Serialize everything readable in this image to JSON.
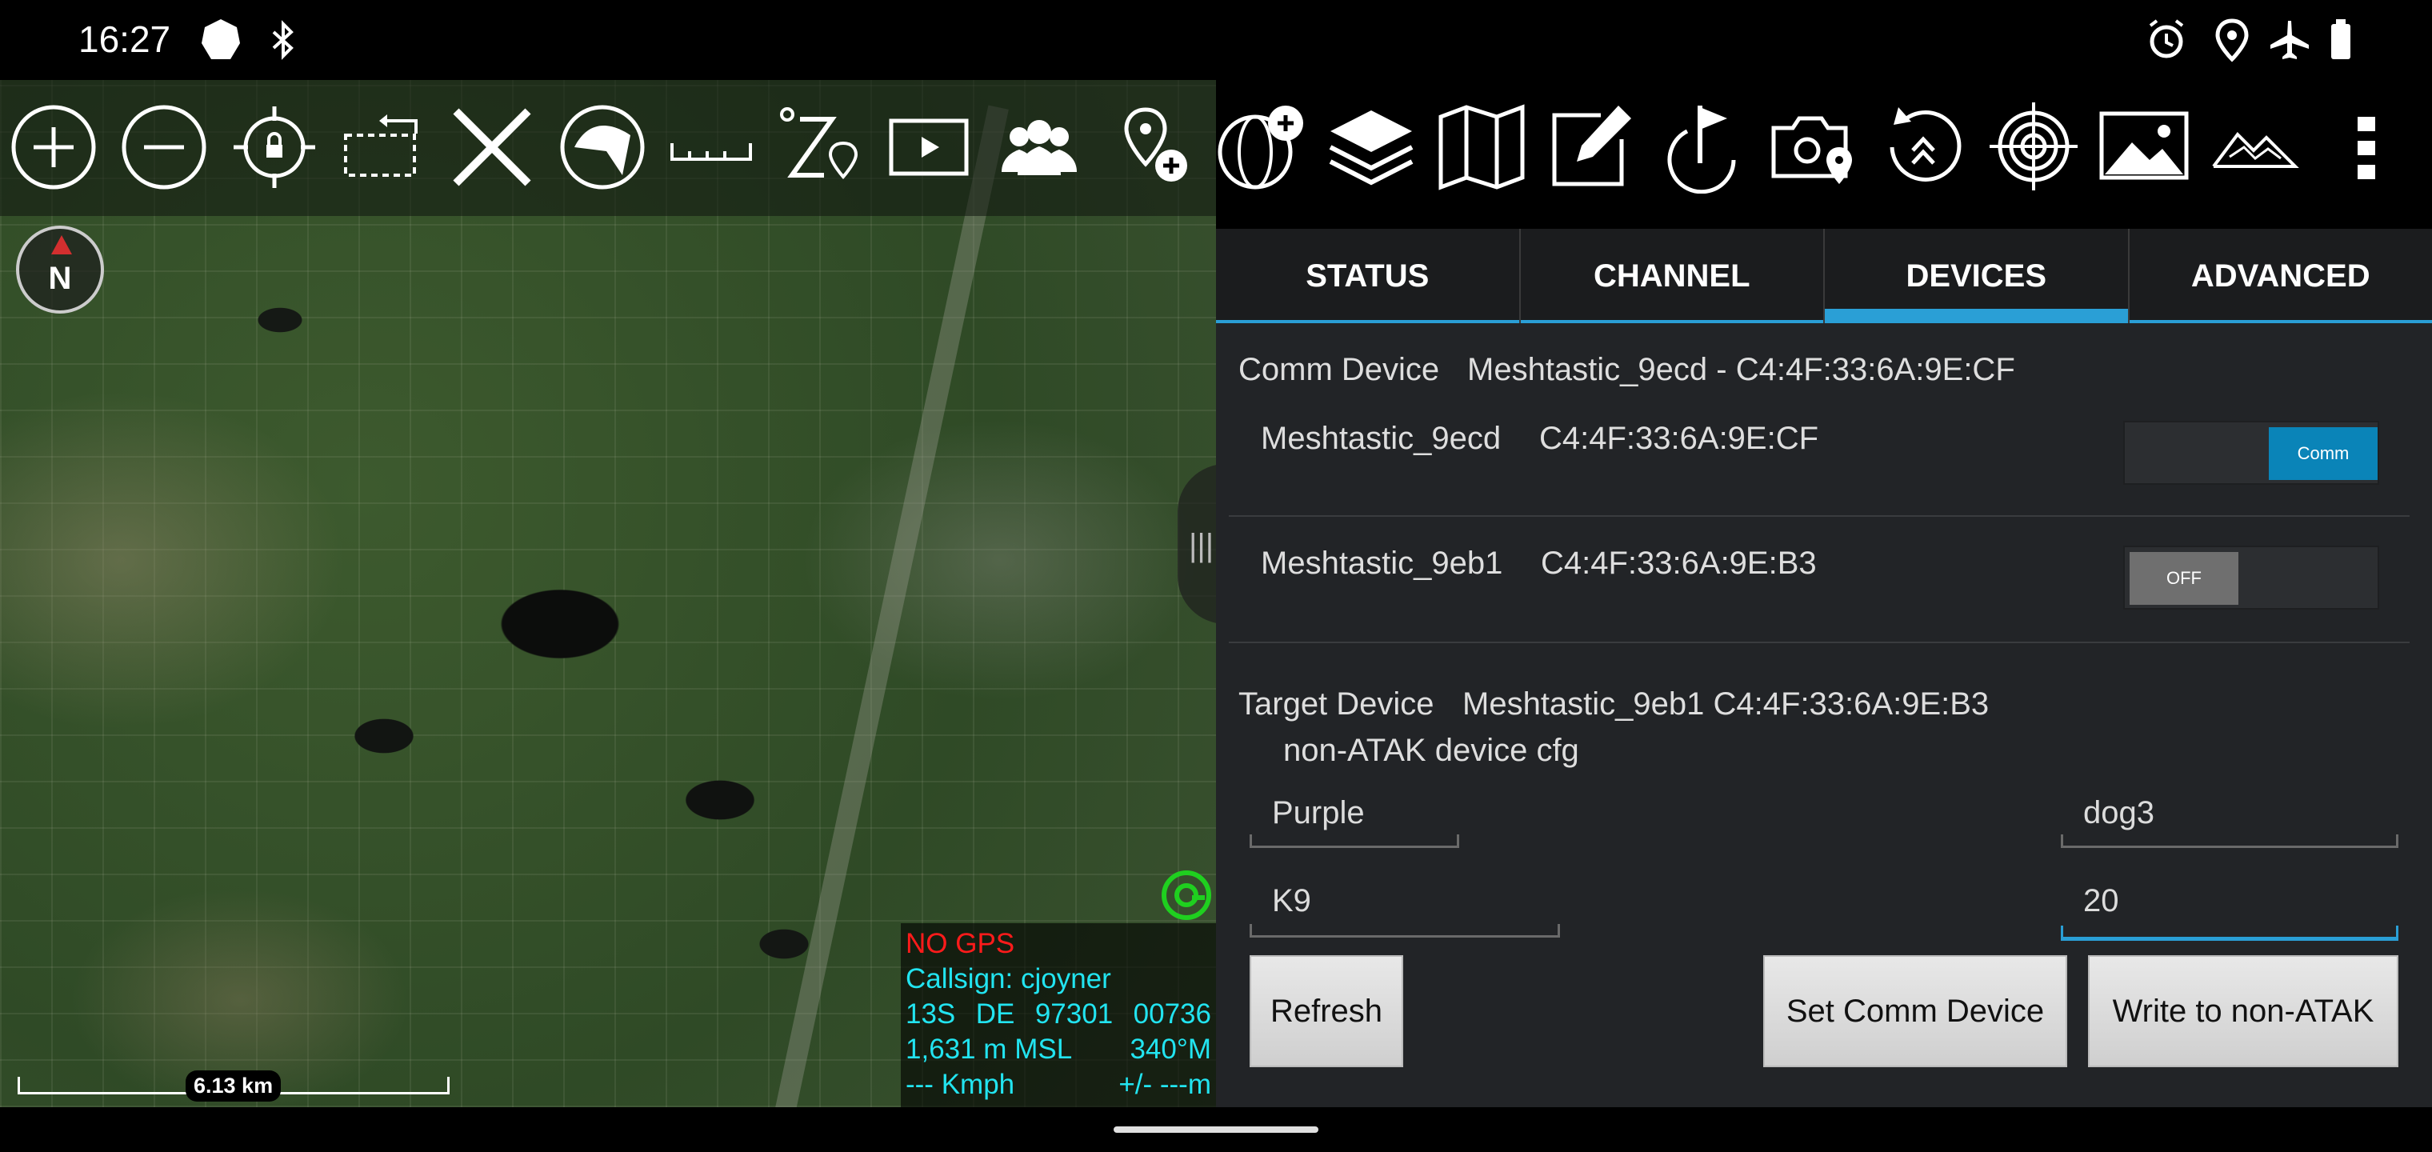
{
  "status_bar": {
    "time": "16:27",
    "left_icons": [
      "settings-badge-icon",
      "bluetooth-icon"
    ],
    "right_icons": [
      "alarm-icon",
      "location-pin-icon",
      "airplane-mode-icon",
      "battery-icon"
    ]
  },
  "map": {
    "toolbar_icons": [
      "zoom-in-icon",
      "zoom-out-icon",
      "lock-location-icon",
      "rotate-screen-icon",
      "close-x-icon",
      "shield-tool-icon",
      "ruler-icon",
      "route-icon",
      "video-icon",
      "contacts-icon",
      "add-point-icon"
    ],
    "compass_label": "N",
    "info": {
      "gps_status": "NO GPS",
      "callsign": "Callsign: cjoyner",
      "mgrs_zone": "13S",
      "mgrs_grid": "DE",
      "mgrs_east": "97301",
      "mgrs_north": "00736",
      "altitude": "1,631 m MSL",
      "heading": "340°M",
      "speed": "--- Kmph",
      "accuracy": "+/- ---m"
    },
    "scale_label": "6.13 km"
  },
  "panel_toolbar_icons": [
    "add-map-icon",
    "layers-icon",
    "map-icon",
    "edit-icon",
    "flag-pointer-icon",
    "camera-location-icon",
    "history-icon",
    "target-icon",
    "image-icon",
    "terrain-icon",
    "overflow-menu-icon"
  ],
  "tabs": [
    {
      "label": "STATUS"
    },
    {
      "label": "CHANNEL"
    },
    {
      "label": "DEVICES"
    },
    {
      "label": "ADVANCED"
    }
  ],
  "active_tab": "DEVICES",
  "devices": {
    "comm_label": "Comm Device",
    "comm_value": "Meshtastic_9ecd - C4:4F:33:6A:9E:CF",
    "list": [
      {
        "name": "Meshtastic_9ecd",
        "mac": "C4:4F:33:6A:9E:CF",
        "toggle": "Comm"
      },
      {
        "name": "Meshtastic_9eb1",
        "mac": "C4:4F:33:6A:9E:B3",
        "toggle": "OFF"
      }
    ],
    "target_label": "Target Device",
    "target_value": "Meshtastic_9eb1 C4:4F:33:6A:9E:B3",
    "nonatak_label": "non-ATAK device cfg",
    "fields": {
      "team": "Purple",
      "callsign": "dog3",
      "role": "K9",
      "number": "20"
    },
    "buttons": {
      "refresh": "Refresh",
      "set_comm": "Set Comm Device",
      "write": "Write to non-ATAK"
    }
  },
  "colors": {
    "accent": "#2a9fd6",
    "panel_bg": "#222427",
    "gps_error": "#ff1b1b",
    "info_text": "#22e4f0"
  }
}
